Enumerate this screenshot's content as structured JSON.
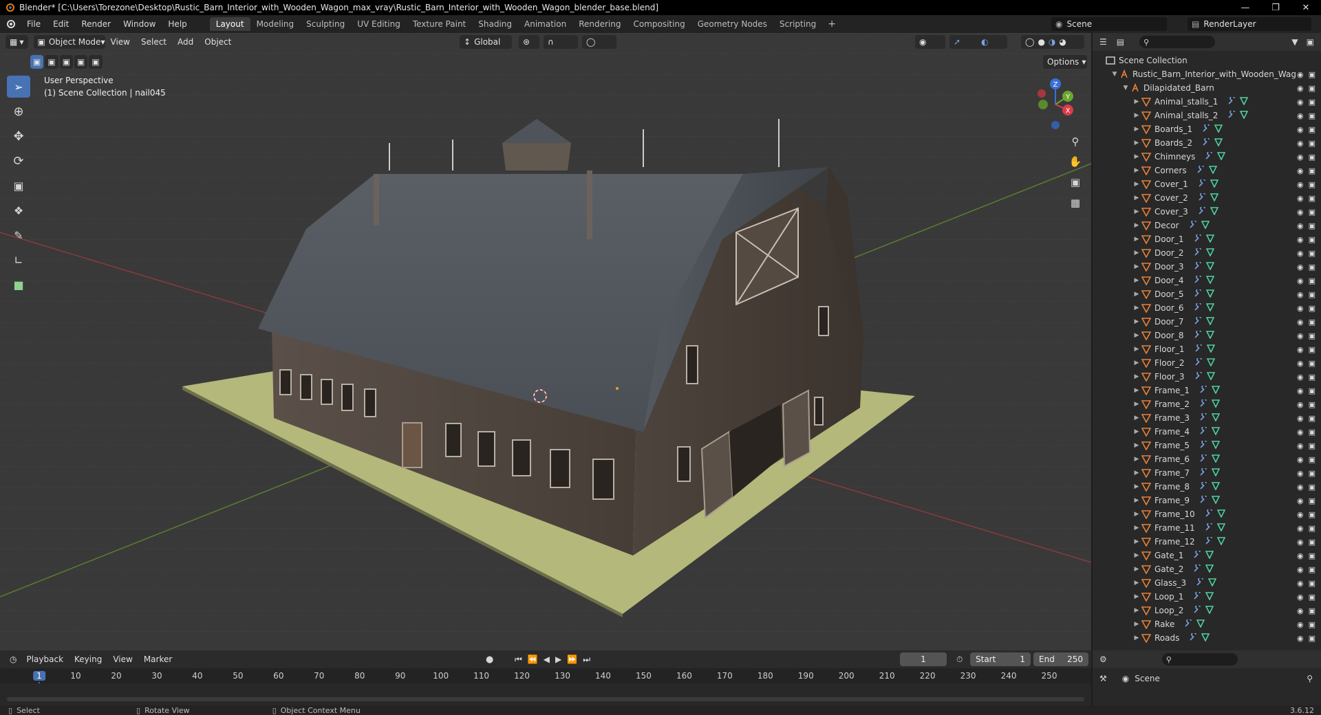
{
  "window": {
    "title": "Blender* [C:\\Users\\Torezone\\Desktop\\Rustic_Barn_Interior_with_Wooden_Wagon_max_vray\\Rustic_Barn_Interior_with_Wooden_Wagon_blender_base.blend]"
  },
  "menu": [
    "File",
    "Edit",
    "Render",
    "Window",
    "Help"
  ],
  "workspaces": [
    "Layout",
    "Modeling",
    "Sculpting",
    "UV Editing",
    "Texture Paint",
    "Shading",
    "Animation",
    "Rendering",
    "Compositing",
    "Geometry Nodes",
    "Scripting"
  ],
  "active_workspace": "Layout",
  "scene_name": "Scene",
  "render_layer": "RenderLayer",
  "viewport": {
    "mode": "Object Mode",
    "menus": [
      "View",
      "Select",
      "Add",
      "Object"
    ],
    "transform_orientation": "Global",
    "options_label": "Options",
    "perspective_label": "User Perspective",
    "collection_label": "(1) Scene Collection | nail045"
  },
  "gizmo": {
    "x": "X",
    "y": "Y",
    "z": "Z"
  },
  "outliner": {
    "root": "Scene Collection",
    "file_collection": "Rustic_Barn_Interior_with_Wooden_Wag",
    "group": "Dilapidated_Barn",
    "items": [
      "Animal_stalls_1",
      "Animal_stalls_2",
      "Boards_1",
      "Boards_2",
      "Chimneys",
      "Corners",
      "Cover_1",
      "Cover_2",
      "Cover_3",
      "Decor",
      "Door_1",
      "Door_2",
      "Door_3",
      "Door_4",
      "Door_5",
      "Door_6",
      "Door_7",
      "Door_8",
      "Floor_1",
      "Floor_2",
      "Floor_3",
      "Frame_1",
      "Frame_2",
      "Frame_3",
      "Frame_4",
      "Frame_5",
      "Frame_6",
      "Frame_7",
      "Frame_8",
      "Frame_9",
      "Frame_10",
      "Frame_11",
      "Frame_12",
      "Gate_1",
      "Gate_2",
      "Glass_3",
      "Loop_1",
      "Loop_2",
      "Rake",
      "Roads"
    ]
  },
  "timeline": {
    "menus": [
      "Playback",
      "Keying",
      "View",
      "Marker"
    ],
    "current_frame": "1",
    "start_label": "Start",
    "start": "1",
    "end_label": "End",
    "end": "250",
    "ticks": [
      "1",
      "10",
      "20",
      "30",
      "40",
      "50",
      "60",
      "70",
      "80",
      "90",
      "100",
      "110",
      "120",
      "130",
      "140",
      "150",
      "160",
      "170",
      "180",
      "190",
      "200",
      "210",
      "220",
      "230",
      "240",
      "250"
    ]
  },
  "properties": {
    "scene_label": "Scene"
  },
  "status": {
    "select": "Select",
    "rotate": "Rotate View",
    "context": "Object Context Menu",
    "version": "3.6.12"
  },
  "colors": {
    "accent": "#4772b3",
    "mesh_icon": "#e8813a",
    "modifier_icon": "#7aa0e6",
    "data_icon": "#4fd1a0"
  }
}
